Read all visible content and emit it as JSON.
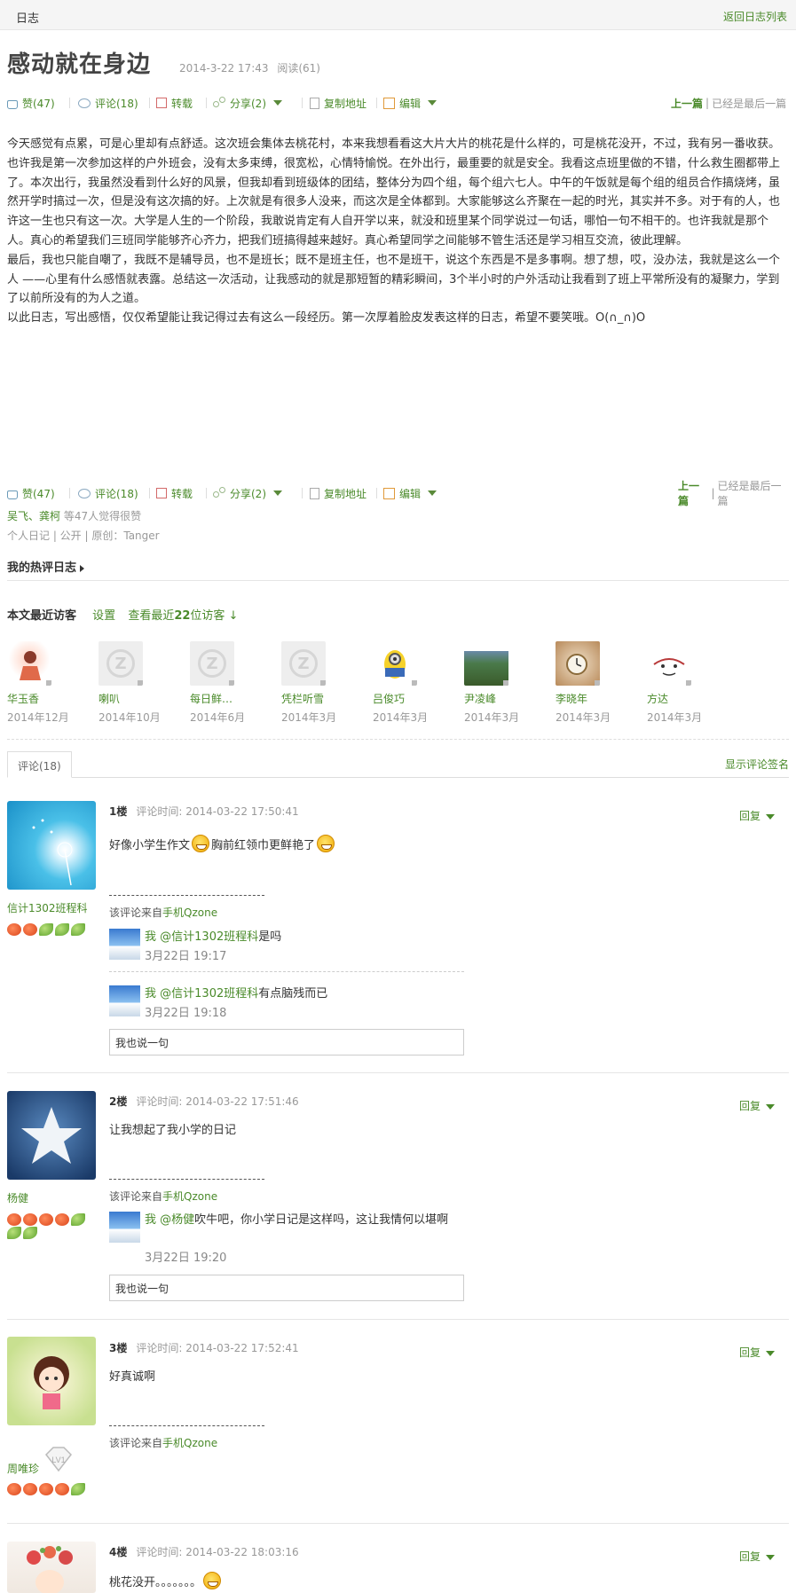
{
  "topbar": {
    "title": "日志",
    "back_link": "返回日志列表"
  },
  "post": {
    "title": "感动就在身边",
    "date": "2014-3-22 17:43",
    "reads": "阅读(61)",
    "paragraphs": [
      "今天感觉有点累，可是心里却有点舒适。这次班会集体去桃花村，本来我想看看这大片大片的桃花是什么样的，可是桃花没开，不过，我有另一番收获。",
      "也许我是第一次参加这样的户外班会，没有太多束缚，很宽松，心情特愉悦。在外出行，最重要的就是安全。我看这点班里做的不错，什么救生圈都带上了。本次出行，我虽然没看到什么好的风景，但我却看到班级体的团结，整体分为四个组，每个组六七人。中午的午饭就是每个组的组员合作搞烧烤，虽然开学时搞过一次，但是没有这次搞的好。上次就是有很多人没来，而这次是全体都到。大家能够这么齐聚在一起的时光，其实并不多。对于有的人，也许这一生也只有这一次。大学是人生的一个阶段，我敢说肯定有人自开学以来，就没和班里某个同学说过一句话，哪怕一句不相干的。也许我就是那个人。真心的希望我们三班同学能够齐心齐力，把我们班搞得越来越好。真心希望同学之间能够不管生活还是学习相互交流，彼此理解。",
      "最后，我也只能自嘲了，我既不是辅导员，也不是班长；既不是班主任，也不是班干，说这个东西是不是多事啊。想了想，哎，没办法，我就是这么一个人 ——心里有什么感悟就表露。总结这一次活动，让我感动的就是那短暂的精彩瞬间，3个半小时的户外活动让我看到了班上平常所没有的凝聚力，学到了以前所没有的为人之道。",
      "以此日志，写出感悟，仅仅希望能让我记得过去有这么一段经历。第一次厚着脸皮发表这样的日志，希望不要笑哦。O(∩_∩)O"
    ]
  },
  "toolbar": {
    "like": "赞(47)",
    "comment": "评论(18)",
    "repost": "转载",
    "share": "分享(2)",
    "copy": "复制地址",
    "edit": "编辑",
    "prev": "上一篇",
    "divider": "|",
    "last": "已经是最后一篇"
  },
  "likers": {
    "names": "吴飞、龚柯",
    "suffix": " 等47人觉得很赞"
  },
  "info": "个人日记 | 公开 | 原创：Tanger",
  "hot": "我的热评日志",
  "visitors": {
    "heading": "本文最近访客",
    "settings": "设置",
    "view_prefix": "查看最近",
    "view_count": "22",
    "view_suffix": "位访客 ↓",
    "list": [
      {
        "name": "华玉香",
        "date": "2014年12月"
      },
      {
        "name": "喇叭",
        "date": "2014年10月"
      },
      {
        "name": "每日鲜…",
        "date": "2014年6月"
      },
      {
        "name": "凭栏听雪",
        "date": "2014年3月"
      },
      {
        "name": "吕俊巧",
        "date": "2014年3月"
      },
      {
        "name": "尹凌峰",
        "date": "2014年3月"
      },
      {
        "name": "李晓年",
        "date": "2014年3月"
      },
      {
        "name": "方达",
        "date": "2014年3月"
      }
    ]
  },
  "comments_tab": {
    "label": "评论(18)",
    "show_sig": "显示评论签名",
    "reply": "回复",
    "say_placeholder": "我也说一句"
  },
  "comments": [
    {
      "floor": "1楼",
      "time": "评论时间: 2014-03-22 17:50:41",
      "author": "信计1302班程科",
      "text_a": "好像小学生作文",
      "text_b": "胸前红领巾更鲜艳了",
      "source_prefix": "该评论来自",
      "source_link": "手机Qzone",
      "replies": [
        {
          "me": "我",
          "at": "@信计1302班程科",
          "text": "是吗",
          "time": "3月22日 19:17"
        },
        {
          "me": "我",
          "at": "@信计1302班程科",
          "text": "有点脑残而已",
          "time": "3月22日 19:18"
        }
      ]
    },
    {
      "floor": "2楼",
      "time": "评论时间: 2014-03-22 17:51:46",
      "author": "杨健",
      "text": "让我想起了我小学的日记",
      "source_prefix": "该评论来自",
      "source_link": "手机Qzone",
      "replies": [
        {
          "me": "我",
          "at": "@杨健",
          "text": "吹牛吧，你小学日记是这样吗，这让我情何以堪啊",
          "time": "3月22日 19:20"
        }
      ]
    },
    {
      "floor": "3楼",
      "time": "评论时间: 2014-03-22 17:52:41",
      "author": "周唯珍",
      "badge": "LV1",
      "text": "好真诚啊",
      "source_prefix": "该评论来自",
      "source_link": "手机Qzone"
    },
    {
      "floor": "4楼",
      "time": "评论时间: 2014-03-22 18:03:16",
      "text": "桃花没开。。。。。。。"
    }
  ],
  "colors": {
    "link": "#4a8a2a",
    "muted": "#999999",
    "topbar_bg": "#f5f5f5"
  }
}
